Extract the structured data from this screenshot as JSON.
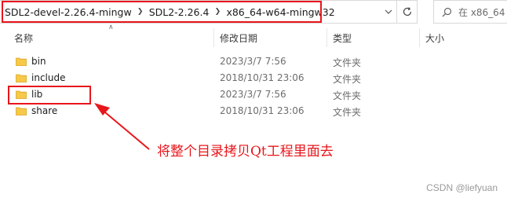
{
  "address_bar": {
    "breadcrumbs": [
      "SDL2-devel-2.26.4-mingw",
      "SDL2-2.26.4",
      "x86_64-w64-mingw32"
    ]
  },
  "search": {
    "placeholder": "在 x86_64"
  },
  "columns": {
    "name": "名称",
    "modified": "修改日期",
    "type": "类型",
    "size": "大小"
  },
  "files": [
    {
      "name": "bin",
      "modified": "2023/3/7 7:56",
      "type": "文件夹",
      "icon": "folder-icon"
    },
    {
      "name": "include",
      "modified": "2018/10/31 23:06",
      "type": "文件夹",
      "icon": "folder-icon"
    },
    {
      "name": "lib",
      "modified": "2023/3/7 7:56",
      "type": "文件夹",
      "icon": "folder-icon"
    },
    {
      "name": "share",
      "modified": "2018/10/31 23:06",
      "type": "文件夹",
      "icon": "folder-icon"
    }
  ],
  "annotation": "将整个目录拷贝Qt工程里面去",
  "watermark": "CSDN @liefyuan",
  "colors": {
    "highlight_red": "#e8161b",
    "folder_yellow": "#f7c948"
  }
}
